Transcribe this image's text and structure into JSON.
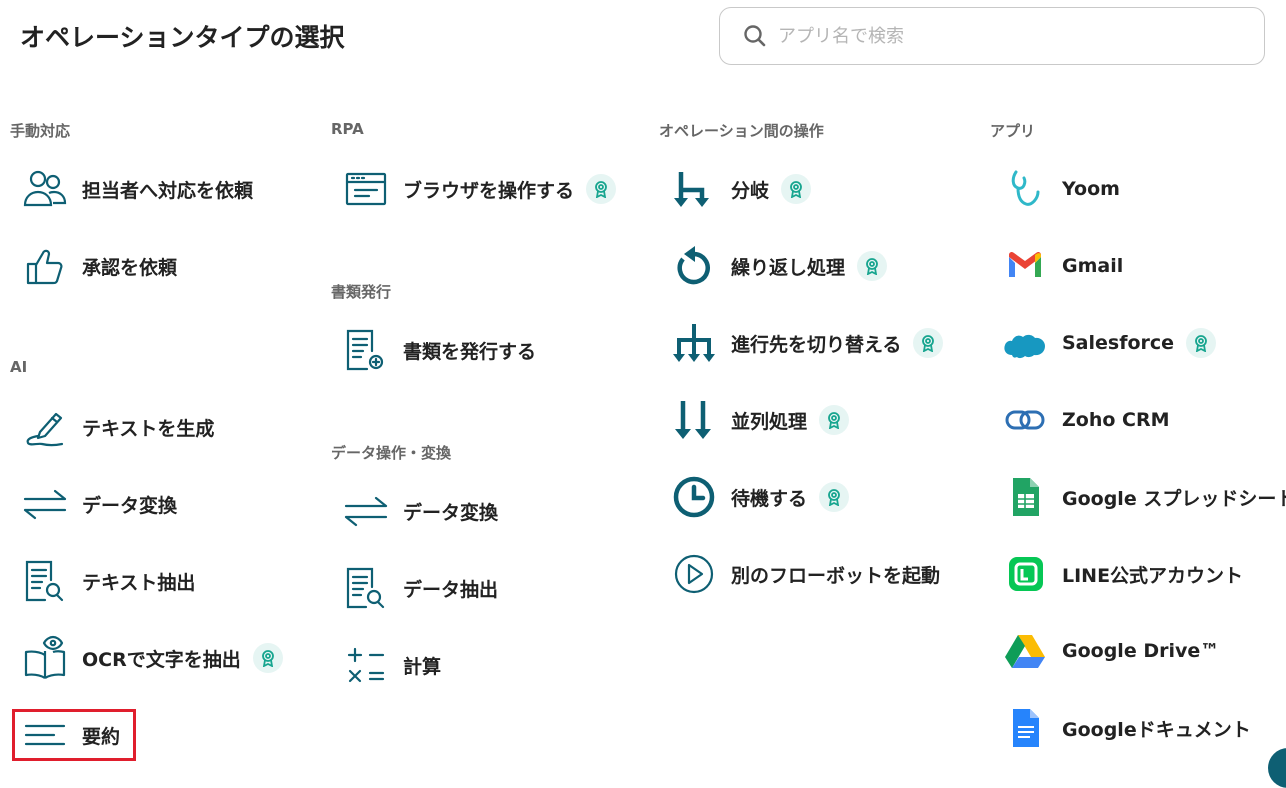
{
  "title": "オペレーションタイプの選択",
  "search": {
    "placeholder": "アプリ名で検索"
  },
  "colors": {
    "icon": "#0e5f73",
    "badge_bg": "#e6f5f3",
    "badge_fg": "#17a58f",
    "highlight": "#e01e2d"
  },
  "col1": {
    "sec_manual": "手動対応",
    "manual": [
      {
        "label": "担当者へ対応を依頼",
        "icon": "people-icon"
      },
      {
        "label": "承認を依頼",
        "icon": "thumbs-up-icon"
      }
    ],
    "sec_ai": "AI",
    "ai": [
      {
        "label": "テキストを生成",
        "icon": "pen-icon"
      },
      {
        "label": "データ変換",
        "icon": "arrows-exchange-icon"
      },
      {
        "label": "テキスト抽出",
        "icon": "doc-search-icon"
      },
      {
        "label": "OCRで文字を抽出",
        "icon": "book-eye-icon",
        "badge": true
      },
      {
        "label": "要約",
        "icon": "lines-icon",
        "highlighted": true
      }
    ]
  },
  "col2": {
    "sec_rpa": "RPA",
    "rpa": [
      {
        "label": "ブラウザを操作する",
        "icon": "browser-icon",
        "badge": true
      }
    ],
    "sec_docs": "書類発行",
    "docs": [
      {
        "label": "書類を発行する",
        "icon": "doc-plus-icon"
      }
    ],
    "sec_data": "データ操作・変換",
    "data": [
      {
        "label": "データ変換",
        "icon": "arrows-exchange-icon"
      },
      {
        "label": "データ抽出",
        "icon": "doc-search-icon"
      },
      {
        "label": "計算",
        "icon": "calculator-icon"
      }
    ]
  },
  "col3": {
    "sec_ops": "オペレーション間の操作",
    "ops": [
      {
        "label": "分岐",
        "icon": "branch-icon",
        "badge": true
      },
      {
        "label": "繰り返し処理",
        "icon": "loop-icon",
        "badge": true
      },
      {
        "label": "進行先を切り替える",
        "icon": "switch-route-icon",
        "badge": true
      },
      {
        "label": "並列処理",
        "icon": "parallel-icon",
        "badge": true
      },
      {
        "label": "待機する",
        "icon": "clock-icon",
        "badge": true
      },
      {
        "label": "別のフローボットを起動",
        "icon": "play-icon"
      }
    ]
  },
  "col4": {
    "sec_apps": "アプリ",
    "apps": [
      {
        "label": "Yoom",
        "icon": "yoom-logo-icon"
      },
      {
        "label": "Gmail",
        "icon": "gmail-logo-icon"
      },
      {
        "label": "Salesforce",
        "icon": "salesforce-logo-icon",
        "badge": true
      },
      {
        "label": "Zoho CRM",
        "icon": "zoho-logo-icon"
      },
      {
        "label": "Google スプレッドシート",
        "icon": "sheets-logo-icon"
      },
      {
        "label": "LINE公式アカウント",
        "icon": "line-logo-icon"
      },
      {
        "label": "Google Drive™",
        "icon": "drive-logo-icon"
      },
      {
        "label": "Googleドキュメント",
        "icon": "docs-logo-icon"
      }
    ]
  }
}
